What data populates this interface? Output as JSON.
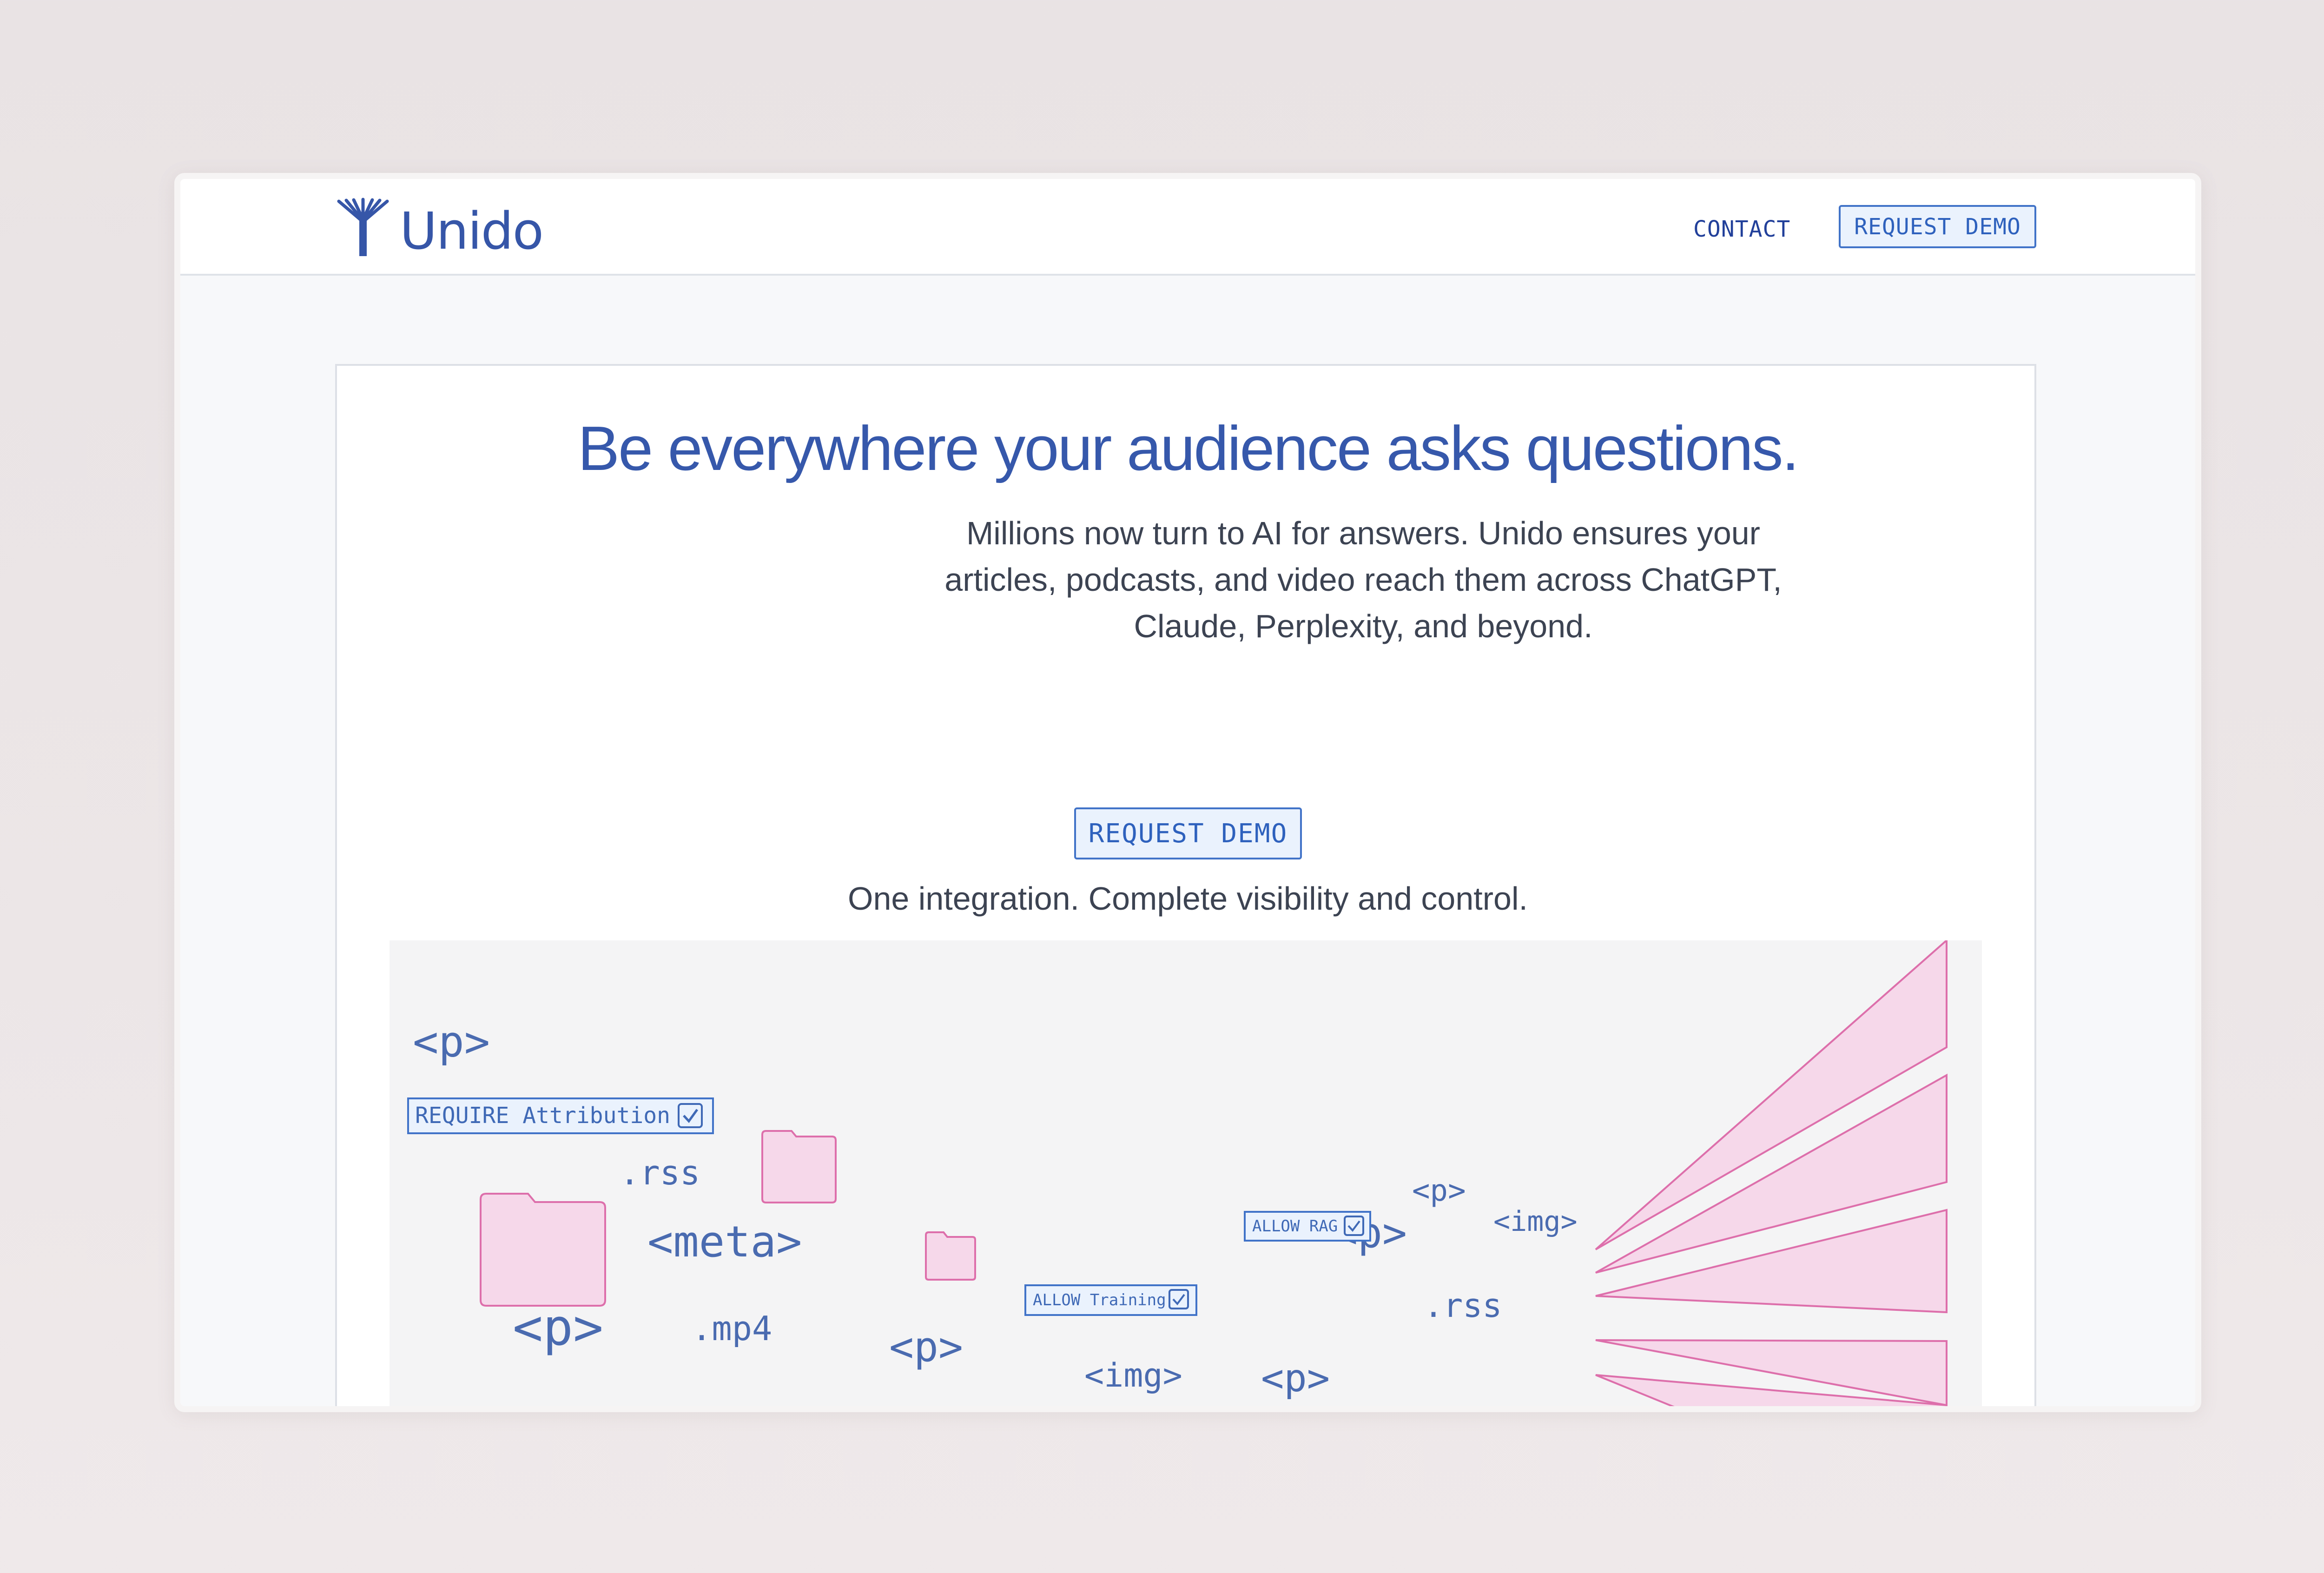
{
  "header": {
    "brand": "Unido",
    "nav": {
      "contact": "CONTACT",
      "request_demo": "REQUEST DEMO"
    }
  },
  "hero": {
    "title": "Be everywhere your audience asks questions.",
    "subtitle_lines": [
      "Millions now turn to AI for answers. Unido ensures your",
      "articles, podcasts, and video reach them across ChatGPT,",
      "Claude, Perplexity, and beyond."
    ],
    "tagline": "One integration. Complete visibility and control.",
    "cta": "REQUEST DEMO"
  },
  "illustration": {
    "tokens": {
      "p": "<p>",
      "meta": "<meta>",
      "img": "<img>",
      "rss": ".rss",
      "mp4": ".mp4"
    },
    "badges": {
      "attribution": "REQUIRE Attribution",
      "training": "ALLOW Training",
      "rag": "ALLOW RAG"
    },
    "colors": {
      "token": "#4a6bb0",
      "pink_fill": "#f6d8ea",
      "pink_stroke": "#dd6fab"
    }
  },
  "colors": {
    "accent": "#3658ab",
    "button_bg": "#eaf2fd",
    "button_border": "#4173c8"
  }
}
